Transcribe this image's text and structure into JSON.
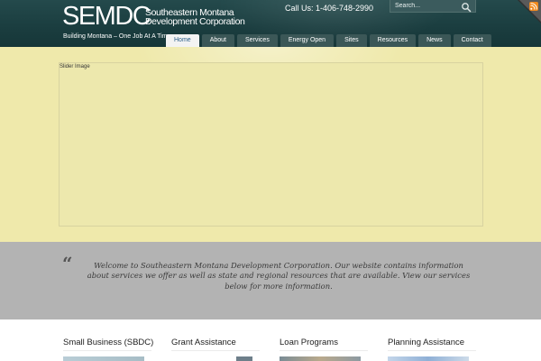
{
  "brand": {
    "mark": "SEMDC",
    "name_line1": "Southeastern Montana",
    "name_line2": "Development Corporation",
    "tagline": "Building Montana – One Job At A Time"
  },
  "header": {
    "phone": "Call Us: 1-406-748-2990",
    "search_placeholder": "Search...",
    "search_icon": "search-icon",
    "rss_icon": "rss-icon"
  },
  "nav": {
    "items": [
      {
        "label": "Home",
        "active": true
      },
      {
        "label": "About"
      },
      {
        "label": "Services"
      },
      {
        "label": "Energy Open"
      },
      {
        "label": "Sites"
      },
      {
        "label": "Resources"
      },
      {
        "label": "News"
      },
      {
        "label": "Contact"
      }
    ]
  },
  "slider": {
    "label": "Slider Image"
  },
  "welcome": {
    "quote_icon": "quote-icon",
    "text": "Welcome to Southeastern Montana Development Corporation. Our website contains information about services we offer as well as state and regional resources that are available. View our services below for more information."
  },
  "services": [
    {
      "title": "Small Business (SBDC)"
    },
    {
      "title": "Grant Assistance"
    },
    {
      "title": "Loan Programs"
    },
    {
      "title": "Planning Assistance"
    }
  ],
  "colors": {
    "header_bg": "#1b3e40",
    "nav_tab_bg": "#3b5757",
    "slider_bg": "#efe9ab",
    "quote_band_bg": "#b3b3b3",
    "rss_orange": "#f28a1e"
  }
}
